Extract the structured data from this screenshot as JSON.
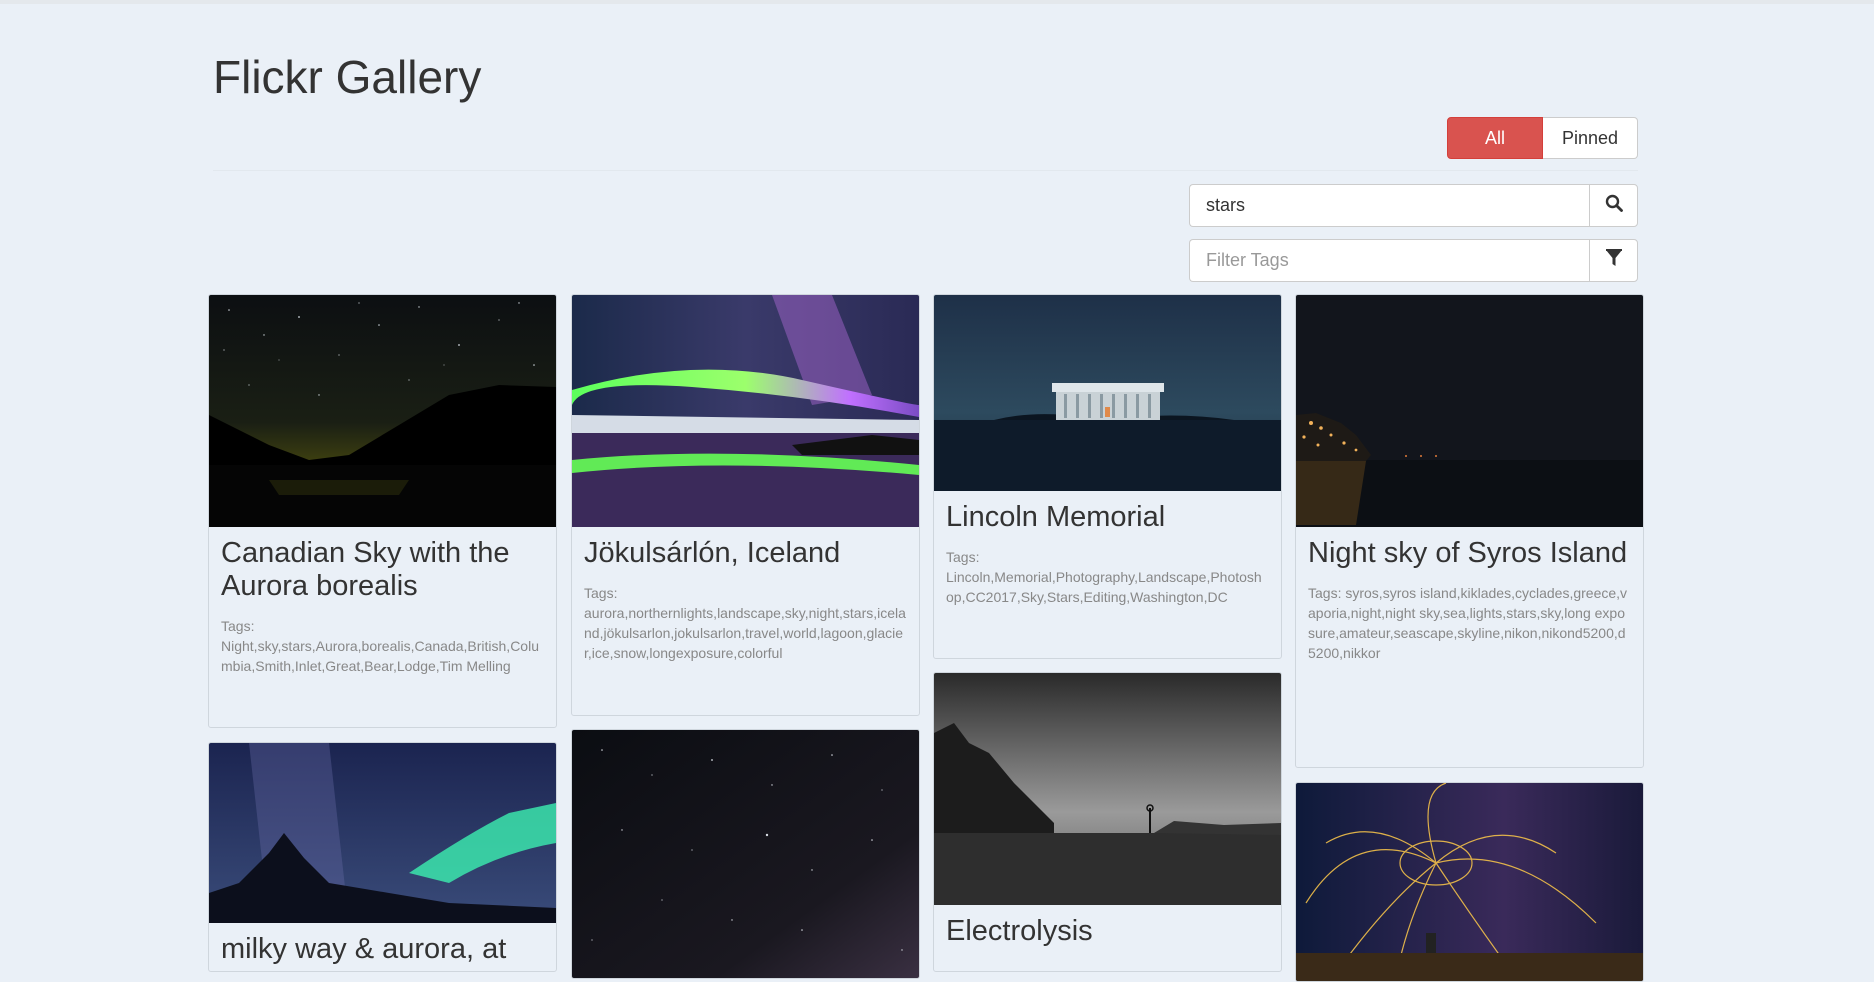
{
  "header": {
    "title": "Flickr Gallery"
  },
  "toggle": {
    "all_label": "All",
    "pinned_label": "Pinned",
    "active": "All",
    "active_color": "#d9534f"
  },
  "search": {
    "value": "stars",
    "icon": "search-icon"
  },
  "filter": {
    "placeholder": "Filter Tags",
    "icon": "filter-icon"
  },
  "photos": [
    {
      "title": "Canadian Sky with the Aurora borealis",
      "tags_label": "Tags:",
      "tags": "Night,sky,stars,Aurora,borealis,Canada,British,Columbia,Smith,Inlet,Great,Bear,Lodge,Tim Melling"
    },
    {
      "title": "Jökulsárlón, Iceland",
      "tags_label": "Tags:",
      "tags": "aurora,northernlights,landscape,sky,night,stars,iceland,jökulsarlon,jokulsarlon,travel,world,lagoon,glacier,ice,snow,longexposure,colorful"
    },
    {
      "title": "Lincoln Memorial",
      "tags_label": "Tags:",
      "tags": "Lincoln,Memorial,Photography,Landscape,Photoshop,CC2017,Sky,Stars,Editing,Washington,DC"
    },
    {
      "title": "Night sky of Syros Island",
      "tags_label": "Tags:",
      "tags": "syros,syros island,kiklades,cyclades,greece,vaporia,night,night sky,sea,lights,stars,sky,long exposure,amateur,seascape,skyline,nikon,nikond5200,d5200,nikkor"
    },
    {
      "title": "milky way & aurora, at"
    },
    {
      "title": ""
    },
    {
      "title": "Electrolysis"
    },
    {
      "title": ""
    }
  ]
}
